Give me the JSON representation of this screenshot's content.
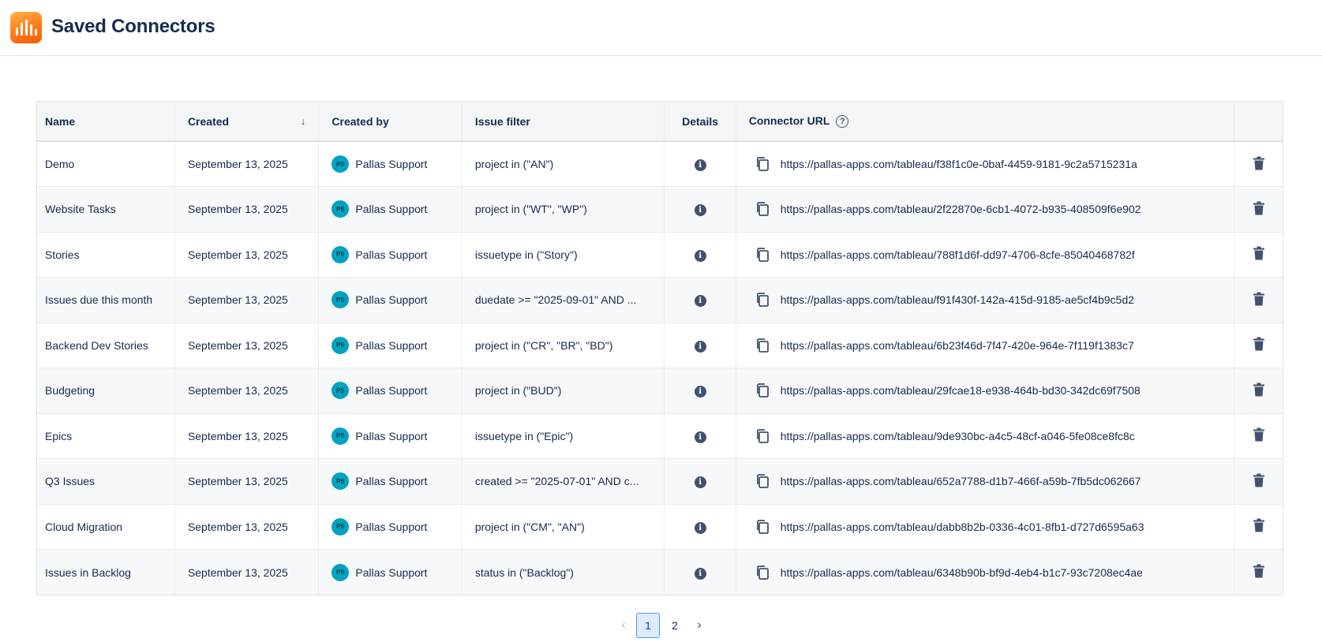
{
  "app": {
    "title": "Saved Connectors"
  },
  "table": {
    "headers": {
      "name": "Name",
      "created": "Created",
      "created_by": "Created by",
      "issue_filter": "Issue filter",
      "details": "Details",
      "connector_url": "Connector URL"
    },
    "sort": {
      "column": "created",
      "direction": "descending"
    },
    "rows": [
      {
        "name": "Demo",
        "created": "September 13, 2025",
        "avatar": "PS",
        "created_by": "Pallas Support",
        "filter": "project in (\"AN\")",
        "url": "https://pallas-apps.com/tableau/f38f1c0e-0baf-4459-9181-9c2a5715231a"
      },
      {
        "name": "Website Tasks",
        "created": "September 13, 2025",
        "avatar": "PS",
        "created_by": "Pallas Support",
        "filter": "project in (\"WT\", \"WP\")",
        "url": "https://pallas-apps.com/tableau/2f22870e-6cb1-4072-b935-408509f6e902"
      },
      {
        "name": "Stories",
        "created": "September 13, 2025",
        "avatar": "PS",
        "created_by": "Pallas Support",
        "filter": "issuetype in (\"Story\")",
        "url": "https://pallas-apps.com/tableau/788f1d6f-dd97-4706-8cfe-85040468782f"
      },
      {
        "name": "Issues due this month",
        "created": "September 13, 2025",
        "avatar": "PS",
        "created_by": "Pallas Support",
        "filter": "duedate >= \"2025-09-01\" AND ...",
        "url": "https://pallas-apps.com/tableau/f91f430f-142a-415d-9185-ae5cf4b9c5d2"
      },
      {
        "name": "Backend Dev Stories",
        "created": "September 13, 2025",
        "avatar": "PS",
        "created_by": "Pallas Support",
        "filter": "project in (\"CR\", \"BR\", \"BD\")",
        "url": "https://pallas-apps.com/tableau/6b23f46d-7f47-420e-964e-7f119f1383c7"
      },
      {
        "name": "Budgeting",
        "created": "September 13, 2025",
        "avatar": "PS",
        "created_by": "Pallas Support",
        "filter": "project in (\"BUD\")",
        "url": "https://pallas-apps.com/tableau/29fcae18-e938-464b-bd30-342dc69f7508"
      },
      {
        "name": "Epics",
        "created": "September 13, 2025",
        "avatar": "PS",
        "created_by": "Pallas Support",
        "filter": "issuetype in (\"Epic\")",
        "url": "https://pallas-apps.com/tableau/9de930bc-a4c5-48cf-a046-5fe08ce8fc8c"
      },
      {
        "name": "Q3 Issues",
        "created": "September 13, 2025",
        "avatar": "PS",
        "created_by": "Pallas Support",
        "filter": "created >= \"2025-07-01\" AND c...",
        "url": "https://pallas-apps.com/tableau/652a7788-d1b7-466f-a59b-7fb5dc062667"
      },
      {
        "name": "Cloud Migration",
        "created": "September 13, 2025",
        "avatar": "PS",
        "created_by": "Pallas Support",
        "filter": "project in (\"CM\", \"AN\")",
        "url": "https://pallas-apps.com/tableau/dabb8b2b-0336-4c01-8fb1-d727d6595a63"
      },
      {
        "name": "Issues in Backlog",
        "created": "September 13, 2025",
        "avatar": "PS",
        "created_by": "Pallas Support",
        "filter": "status in (\"Backlog\")",
        "url": "https://pallas-apps.com/tableau/6348b90b-bf9d-4eb4-b1c7-93c7208ec4ae"
      }
    ]
  },
  "pagination": {
    "pages": [
      "1",
      "2"
    ],
    "current": "1",
    "prev_icon": "chevron-left-icon",
    "next_icon": "chevron-right-icon"
  },
  "icons": {
    "sort": "arrow-down-icon",
    "help": "question-circle-icon",
    "details": "info-icon",
    "copy": "copy-icon",
    "delete": "trash-icon"
  },
  "colors": {
    "accent": "#ff7a1a",
    "avatar": "#00a3bf",
    "active_page": "#deebff"
  }
}
